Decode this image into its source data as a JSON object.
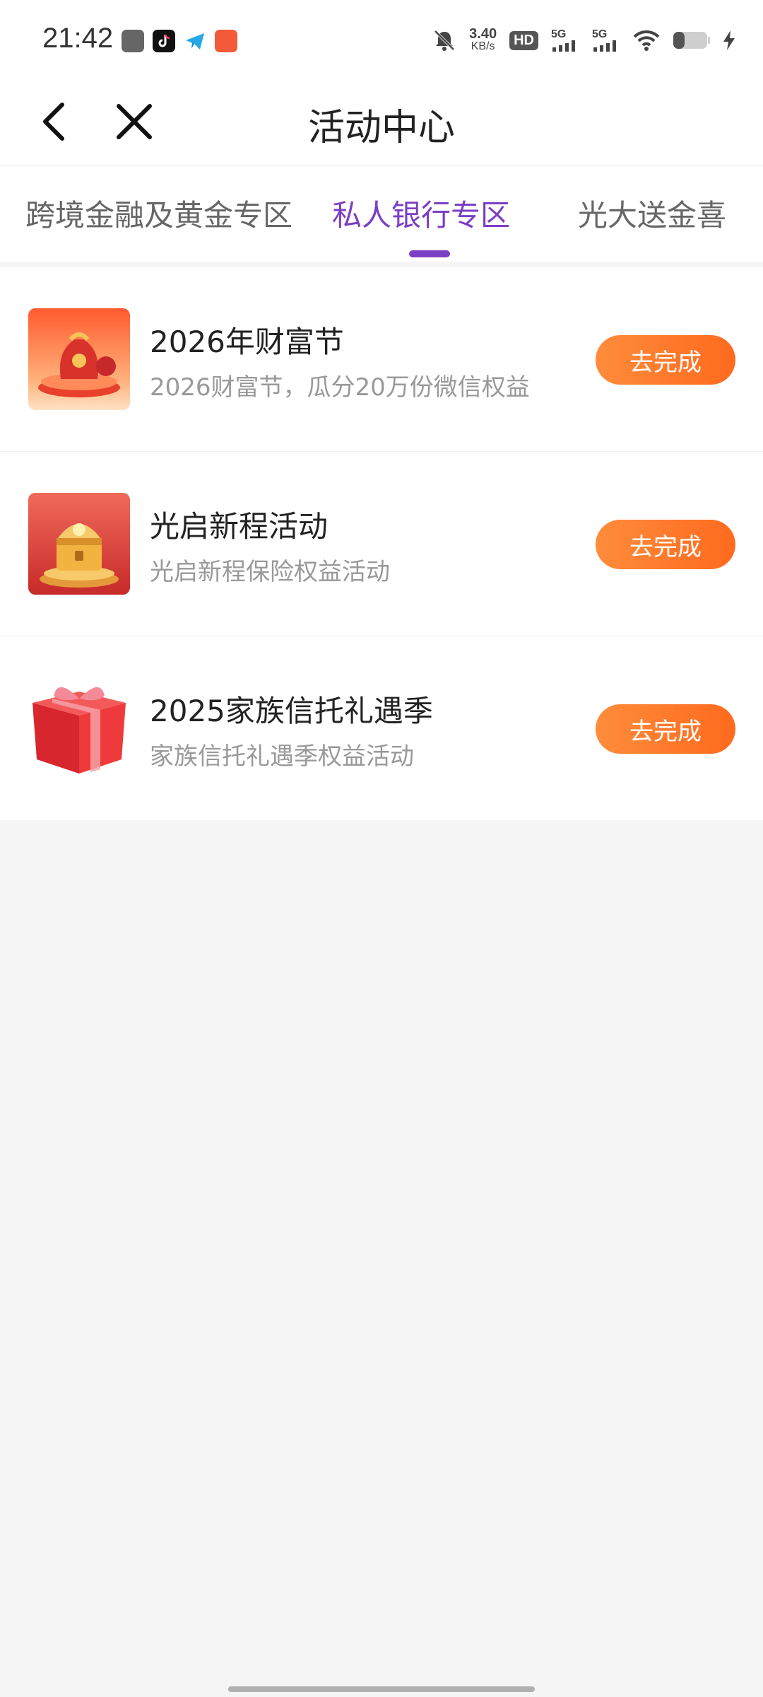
{
  "status_bar": {
    "time": "21:42",
    "net_speed_value": "3.40",
    "net_speed_unit": "KB/s",
    "hd_label": "HD",
    "sim1_label": "5G",
    "sim2_label": "5G",
    "icons": [
      "gallery-icon",
      "tiktok-icon",
      "telegram-icon",
      "app-icon",
      "mute-bell-icon",
      "wifi-icon",
      "battery-icon",
      "charging-icon"
    ]
  },
  "header": {
    "title": "活动中心",
    "back_icon": "chevron-left-icon",
    "close_icon": "close-icon"
  },
  "tabs": [
    {
      "label": "跨境金融及黄金专区",
      "active": false
    },
    {
      "label": "私人银行专区",
      "active": true
    },
    {
      "label": "光大送金喜",
      "active": false
    }
  ],
  "activities": [
    {
      "title": "2026年财富节",
      "subtitle": "2026财富节，瓜分20万份微信权益",
      "button": "去完成",
      "thumb": "gift-bag-stage-icon"
    },
    {
      "title": "光启新程活动",
      "subtitle": "光启新程保险权益活动",
      "button": "去完成",
      "thumb": "treasure-chest-icon"
    },
    {
      "title": "2025家族信托礼遇季",
      "subtitle": "家族信托礼遇季权益活动",
      "button": "去完成",
      "thumb": "gift-box-icon"
    }
  ],
  "colors": {
    "accent": "#7b3fc4",
    "button": "#ff7a2a",
    "background": "#f5f5f5"
  }
}
